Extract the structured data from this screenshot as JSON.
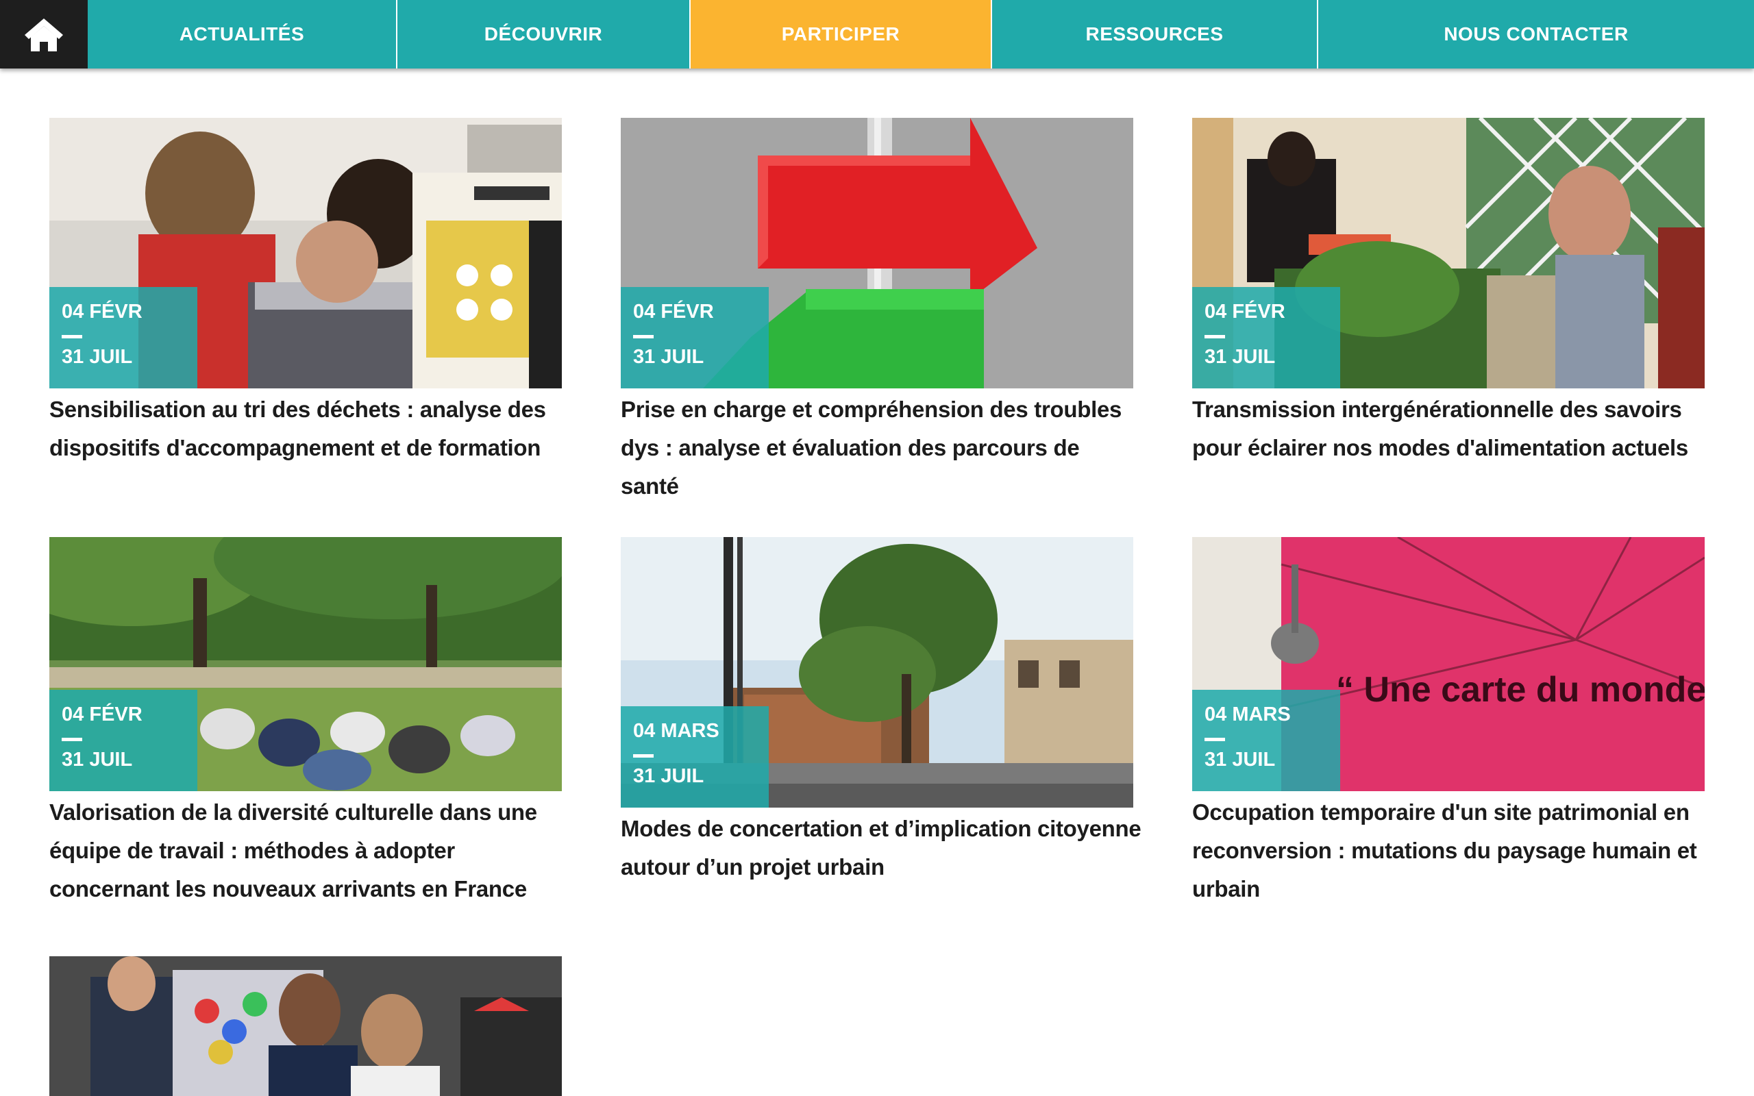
{
  "nav": {
    "home_icon": "home-icon",
    "items": [
      {
        "label": "ACTUALITÉS"
      },
      {
        "label": "DÉCOUVRIR"
      },
      {
        "label": "PARTICIPER",
        "active": true
      },
      {
        "label": "RESSOURCES"
      },
      {
        "label": "NOUS CONTACTER"
      }
    ]
  },
  "colors": {
    "teal": "#20aaaa",
    "active_orange": "#fbb430",
    "home_bg": "#1e1e1e",
    "title_text": "#1c1c1c"
  },
  "cards": [
    {
      "start": "04 FÉVR",
      "end": "31 JUIL",
      "title": "Sensibilisation au tri des déchets : analyse des dispositifs d'accompagnement et de formation",
      "image": "workshop-sorting-poster-image"
    },
    {
      "start": "04 FÉVR",
      "end": "31 JUIL",
      "title": "Prise en charge et compréhension des troubles dys : analyse et évaluation des parcours de santé",
      "image": "red-green-arrows-image"
    },
    {
      "start": "04 FÉVR",
      "end": "31 JUIL",
      "title": "Transmission intergénérationnelle des savoirs pour éclairer nos modes d'alimentation actuels",
      "image": "vegetable-stand-image"
    },
    {
      "start": "04 FÉVR",
      "end": "31 JUIL",
      "title": "Valorisation de la diversité culturelle dans une équipe de travail : méthodes à adopter concernant les nouveaux arrivants en France",
      "image": "park-group-image"
    },
    {
      "start": "04 MARS",
      "end": "31 JUIL",
      "title": "Modes de concertation et d’implication citoyenne autour d’un projet urbain",
      "image": "urban-square-image"
    },
    {
      "start": "04 MARS",
      "end": "31 JUIL",
      "title": "Occupation temporaire d'un site patrimonial en reconversion : mutations du paysage humain et urbain",
      "image": "pink-wall-quote-image",
      "image_text": "“ Une carte du monde qui n’inclut pas l’utopie ne mérite"
    },
    {
      "image": "street-young-men-image"
    }
  ]
}
